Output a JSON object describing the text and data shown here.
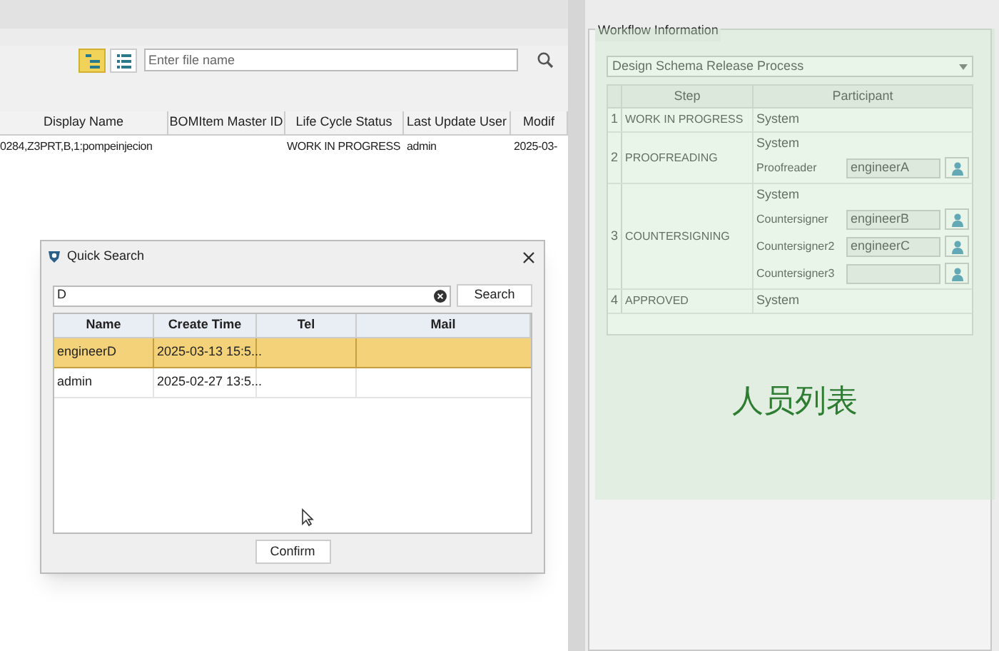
{
  "toolbar": {
    "view_buttons": [
      {
        "kind": "tree",
        "selected": true
      },
      {
        "kind": "list",
        "selected": false
      }
    ],
    "search": {
      "placeholder": "Enter file name"
    }
  },
  "table": {
    "columns": [
      "Display Name",
      "BOMItem Master ID",
      "Life Cycle Status",
      "Last Update User",
      "Modif"
    ],
    "rows": [
      {
        "display_name": "0284,Z3PRT,B,1:pompeinjecion",
        "life_cycle_status": "WORK IN PROGRESS",
        "last_update_user": "admin",
        "modified": "2025-03-"
      }
    ]
  },
  "workflow": {
    "title": "Workflow Information",
    "process": "Design Schema Release Process",
    "columns": [
      "Step",
      "Participant"
    ],
    "steps": [
      {
        "number": "1",
        "name": "WORK IN PROGRESS",
        "participants": [
          {
            "kind": "text",
            "label": "System"
          }
        ]
      },
      {
        "number": "2",
        "name": "PROOFREADING",
        "participants": [
          {
            "kind": "text",
            "label": "System"
          },
          {
            "kind": "field",
            "label": "Proofreader",
            "value": "engineerA"
          }
        ]
      },
      {
        "number": "3",
        "name": "COUNTERSIGNING",
        "participants": [
          {
            "kind": "text",
            "label": "System"
          },
          {
            "kind": "field",
            "label": "Countersigner",
            "value": "engineerB"
          },
          {
            "kind": "field",
            "label": "Countersigner2",
            "value": "engineerC"
          },
          {
            "kind": "field",
            "label": "Countersigner3"
          }
        ]
      },
      {
        "number": "4",
        "name": "APPROVED",
        "participants": [
          {
            "kind": "text",
            "label": "System"
          }
        ]
      }
    ]
  },
  "overlay": {
    "label": "人员列表"
  },
  "dialog": {
    "title": "Quick Search",
    "query": "D",
    "search_button": "Search",
    "columns": [
      "Name",
      "Create Time",
      "Tel",
      "Mail"
    ],
    "rows": [
      {
        "name": "engineerD",
        "create_time": "2025-03-13 15:5...",
        "selected": true
      },
      {
        "name": "admin",
        "create_time": "2025-02-27 13:5...",
        "selected": false
      }
    ],
    "confirm_button": "Confirm"
  }
}
